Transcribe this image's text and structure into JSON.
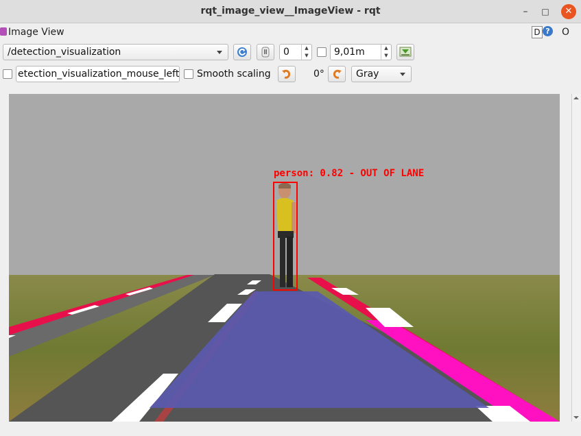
{
  "window": {
    "title": "rqt_image_view__ImageView - rqt",
    "minimize": "–",
    "maximize": "□",
    "close": "✕"
  },
  "plugin": {
    "title": "Image View",
    "d_label": "D",
    "help_label": "?",
    "extra_label": "O"
  },
  "toolbar": {
    "topic": "/detection_visualization",
    "refresh_icon": "refresh-icon",
    "spin_value": "0",
    "max_range": "9,01m",
    "mouse_topic": "etection_visualization_mouse_left",
    "smooth_scaling_label": "Smooth scaling",
    "rotation_label": "0°",
    "color_scheme": "Gray"
  },
  "detection": {
    "label": "person: 0.82 - OUT OF LANE",
    "color": "#ff0000"
  },
  "colors": {
    "sky": "#a9a9a9",
    "grass": "#7a7a3a",
    "road": "#555555",
    "lane_overlay": "#5a5ab0",
    "curb_red": "#e8104a",
    "curb_magenta": "#ff10c0"
  }
}
